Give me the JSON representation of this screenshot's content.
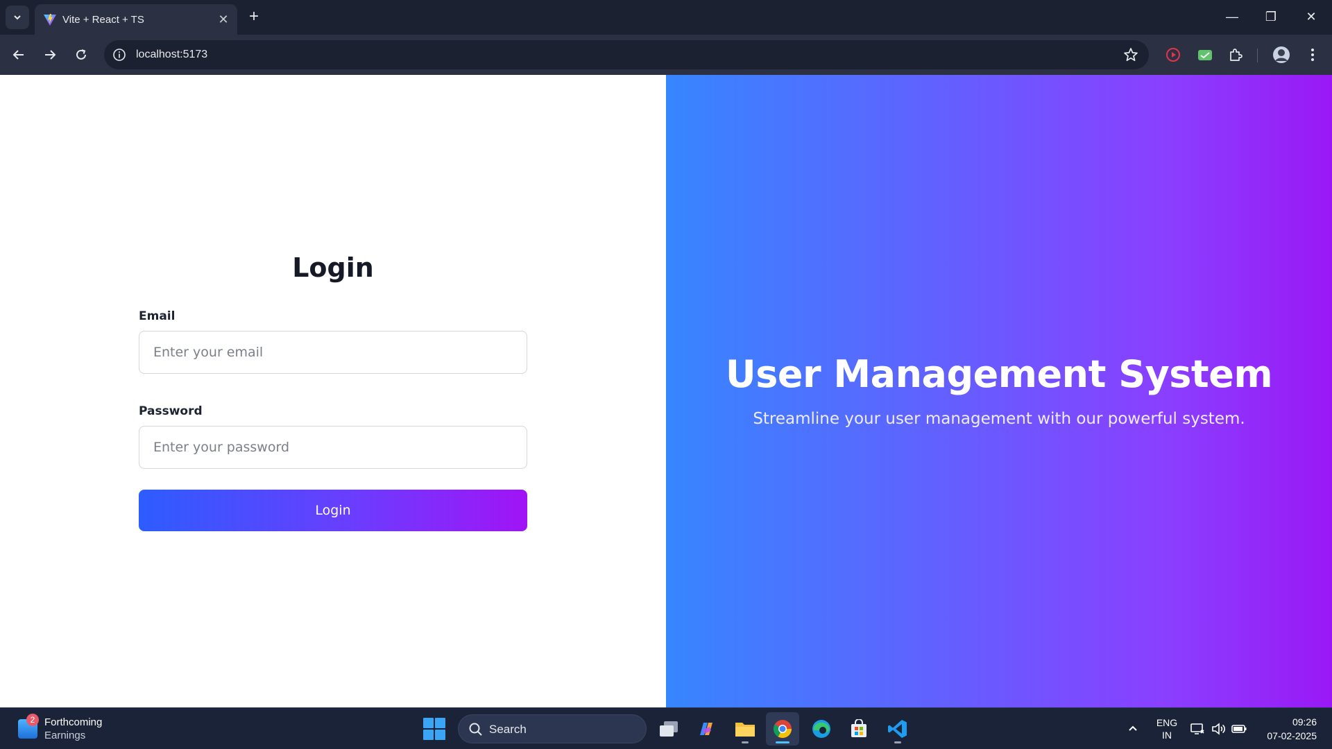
{
  "browser": {
    "tab_title": "Vite + React + TS",
    "url": "localhost:5173"
  },
  "login": {
    "heading": "Login",
    "email_label": "Email",
    "email_placeholder": "Enter your email",
    "email_value": "",
    "password_label": "Password",
    "password_placeholder": "Enter your password",
    "password_value": "",
    "button_label": "Login"
  },
  "hero": {
    "title": "User Management System",
    "subtitle": "Streamline your user management with our powerful system."
  },
  "taskbar": {
    "widget_badge": "2",
    "widget_title": "Forthcoming",
    "widget_subtitle": "Earnings",
    "search_label": "Search",
    "apps": [
      "task-view",
      "copilot",
      "file-explorer",
      "chrome",
      "edge",
      "microsoft-store",
      "vs-code"
    ],
    "active_app": "chrome"
  },
  "tray": {
    "lang_line1": "ENG",
    "lang_line2": "IN",
    "time": "09:26",
    "date": "07-02-2025"
  },
  "colors": {
    "gradient_start": "#3686ff",
    "gradient_end": "#9a18f5",
    "button_start": "#2d5cff",
    "button_end": "#a114f5"
  }
}
